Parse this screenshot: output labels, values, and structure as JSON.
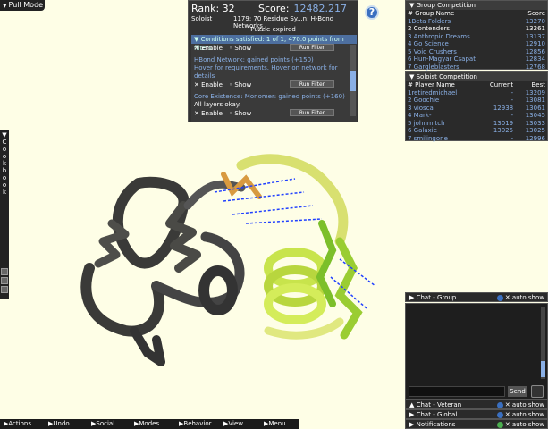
{
  "top": {
    "pull_mode": "Pull Mode"
  },
  "cookbook": {
    "label": [
      "C",
      "o",
      "o",
      "k",
      "b",
      "o",
      "o",
      "k"
    ]
  },
  "score_panel": {
    "rank_label": "Rank: 32",
    "score_label": "Score:",
    "score_value": "12482.217",
    "mode": "Soloist",
    "puzzle": "1179: 70 Residue Sy...n: H-Bond Networks",
    "status": "Puzzle expired",
    "conditions_header": "Conditions satisfied:  1 of 1, 470.0 points from filters",
    "enable": "Enable",
    "show": "Show",
    "run_filter": "Run Filter",
    "filter1_title": "HBond Network: gained points (+150)",
    "filter1_text": "Hover for requirements. Hover on network for details",
    "filter2_title": "Core Existence: Monomer: gained points (+160)",
    "filter2_text": "All layers okay."
  },
  "group_competition": {
    "header": "Group Competition",
    "col_name": "# Group Name",
    "col_score": "Score",
    "rows": [
      {
        "name": "1Beta Folders",
        "score": "13270"
      },
      {
        "name": "2 Contenders",
        "score": "13261"
      },
      {
        "name": "3 Anthropic Dreams",
        "score": "13137"
      },
      {
        "name": "4 Go Science",
        "score": "12910"
      },
      {
        "name": "5 Void Crushers",
        "score": "12856"
      },
      {
        "name": "6 Hun-Magyar Csapat",
        "score": "12834"
      },
      {
        "name": "7 Gargleblasters",
        "score": "12768"
      }
    ]
  },
  "soloist_competition": {
    "header": "Soloist Competition",
    "col_name": "# Player Name",
    "col_current": "Current",
    "col_best": "Best",
    "rows": [
      {
        "name": "1retiredmichael",
        "current": "-",
        "best": "13209"
      },
      {
        "name": "2 Goochie",
        "current": "-",
        "best": "13081"
      },
      {
        "name": "3 viosca",
        "current": "12938",
        "best": "13061"
      },
      {
        "name": "4 Mark-",
        "current": "-",
        "best": "13045"
      },
      {
        "name": "5 johnmitch",
        "current": "13019",
        "best": "13033"
      },
      {
        "name": "6 Galaxie",
        "current": "13025",
        "best": "13025"
      },
      {
        "name": "7 smilingone",
        "current": "-",
        "best": "12996"
      }
    ]
  },
  "chat": {
    "group": "Chat - Group",
    "veteran": "Chat - Veteran",
    "global": "Chat - Global",
    "notifications": "Notifications",
    "auto_show": "auto show",
    "send": "Send"
  },
  "menu": {
    "actions": "Actions",
    "undo": "Undo",
    "social": "Social",
    "modes": "Modes",
    "behavior": "Behavior",
    "view": "View",
    "menu": "Menu"
  }
}
